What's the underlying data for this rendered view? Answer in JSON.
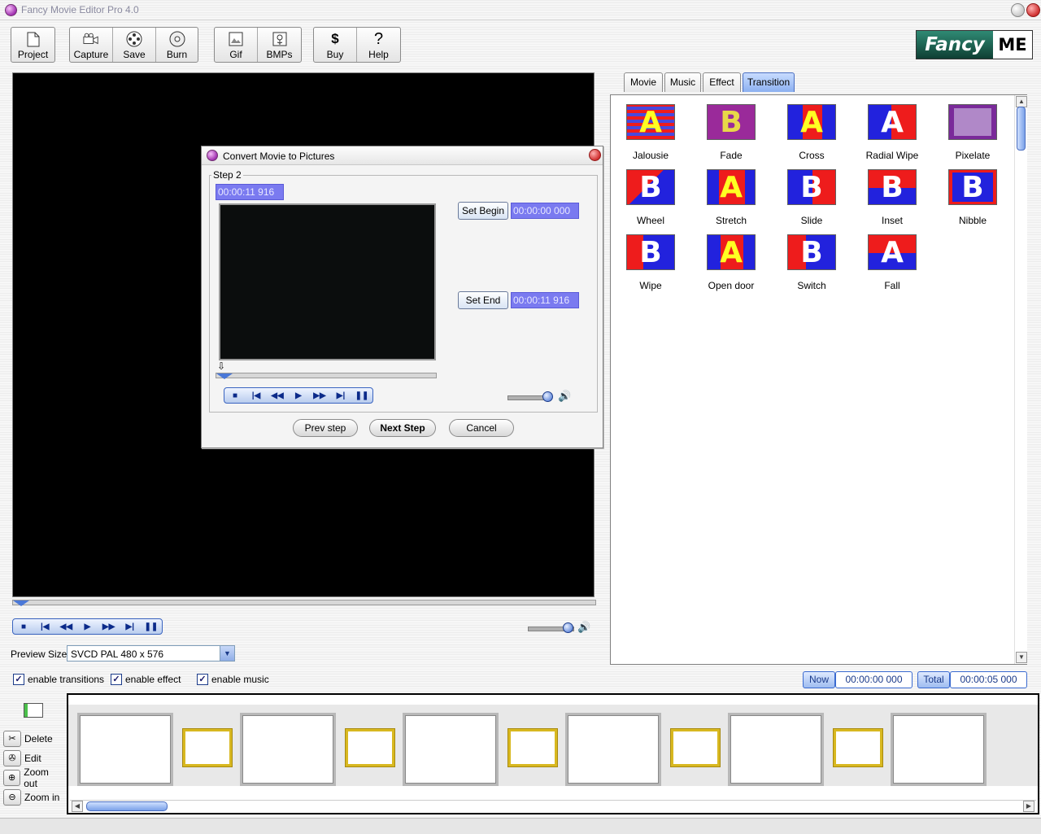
{
  "window": {
    "title": "Fancy Movie Editor Pro 4.0"
  },
  "toolbar": {
    "project": "Project",
    "capture": "Capture",
    "save": "Save",
    "burn": "Burn",
    "gif": "Gif",
    "bmps": "BMPs",
    "buy": "Buy",
    "help": "Help"
  },
  "logo": {
    "part1": "Fancy",
    "part2": "ME"
  },
  "preview": {
    "size_label": "Preview Size",
    "size_value": "SVCD PAL 480 x 576"
  },
  "tabs": [
    {
      "label": "Movie",
      "active": false
    },
    {
      "label": "Music",
      "active": false
    },
    {
      "label": "Effect",
      "active": false
    },
    {
      "label": "Transition",
      "active": true
    }
  ],
  "transitions": [
    {
      "name": "Jalousie",
      "letter": "A",
      "icon": "jalousie-icon"
    },
    {
      "name": "Fade",
      "letter": "B",
      "icon": "fade-icon"
    },
    {
      "name": "Cross",
      "letter": "A",
      "icon": "cross-icon"
    },
    {
      "name": "Radial Wipe",
      "letter": "A",
      "icon": "radial-wipe-icon"
    },
    {
      "name": "Pixelate",
      "letter": "",
      "icon": "pixelate-icon"
    },
    {
      "name": "Wheel",
      "letter": "B",
      "icon": "wheel-icon"
    },
    {
      "name": "Stretch",
      "letter": "A",
      "icon": "stretch-icon"
    },
    {
      "name": "Slide",
      "letter": "B",
      "icon": "slide-icon"
    },
    {
      "name": "Inset",
      "letter": "B",
      "icon": "inset-icon"
    },
    {
      "name": "Nibble",
      "letter": "B",
      "icon": "nibble-icon"
    },
    {
      "name": "Wipe",
      "letter": "B",
      "icon": "wipe-icon"
    },
    {
      "name": "Open door",
      "letter": "A",
      "icon": "open-door-icon"
    },
    {
      "name": "Switch",
      "letter": "B",
      "icon": "switch-icon"
    },
    {
      "name": "Fall",
      "letter": "A",
      "icon": "fall-icon"
    }
  ],
  "dialog": {
    "title": "Convert Movie to Pictures",
    "step": "Step 2",
    "current_time": "00:00:11 916",
    "set_begin": "Set Begin",
    "begin_time": "00:00:00 000",
    "set_end": "Set End",
    "end_time": "00:00:11 916",
    "prev": "Prev step",
    "next": "Next Step",
    "cancel": "Cancel"
  },
  "options": {
    "transitions": "enable transitions",
    "effect": "enable effect",
    "music": "enable music"
  },
  "status": {
    "now_label": "Now",
    "now_value": "00:00:00 000",
    "total_label": "Total",
    "total_value": "00:00:05 000"
  },
  "timeline_tools": {
    "delete": "Delete",
    "edit": "Edit",
    "zoom_out": "Zoom out",
    "zoom_in": "Zoom in"
  },
  "colors": {
    "accent": "#7a7af0",
    "panel_blue": "#3a6ad0",
    "transition_red": "#ee1c1c",
    "transition_blue": "#2222dd",
    "transition_yellow": "#ffff22"
  }
}
